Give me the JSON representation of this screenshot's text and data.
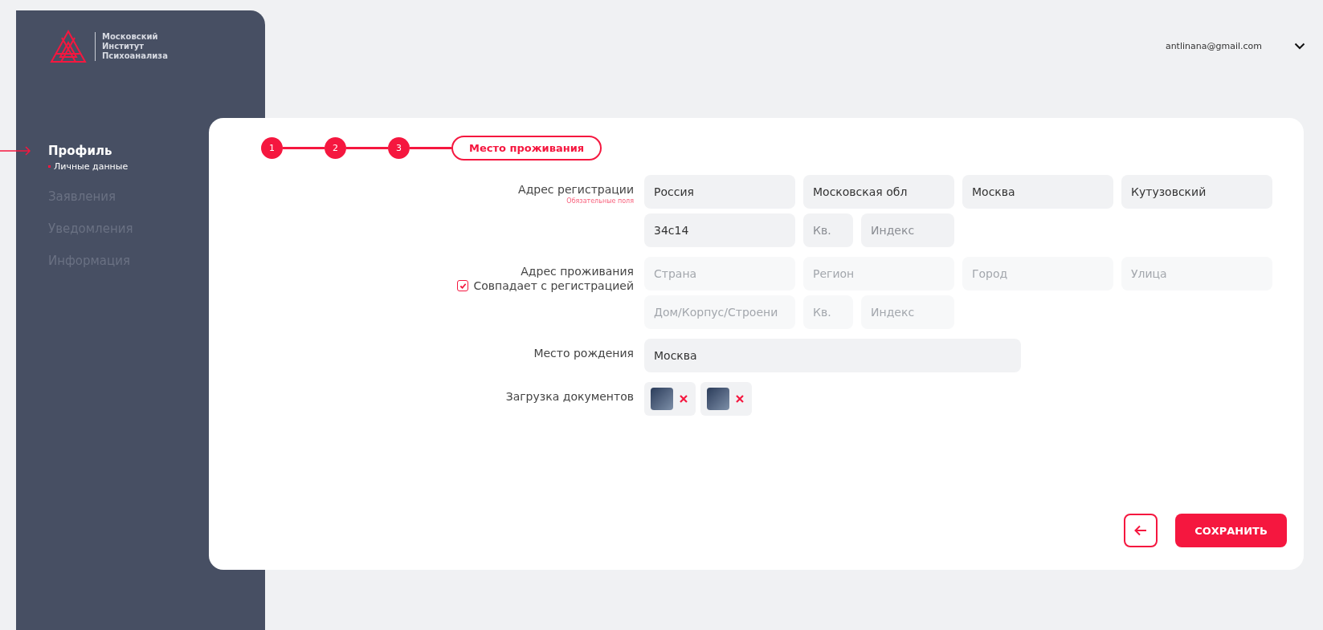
{
  "logo": {
    "lines": [
      "Московский",
      "Институт",
      "Психоанализа"
    ]
  },
  "sidebar": {
    "items": [
      {
        "label": "Профиль",
        "selected": true,
        "children": [
          {
            "label": "Личные данные",
            "selected": true
          }
        ]
      },
      {
        "label": "Заявления",
        "selected": false
      },
      {
        "label": "Уведомления",
        "selected": false
      },
      {
        "label": "Информация",
        "selected": false
      }
    ]
  },
  "user": {
    "email": "antlinana@gmail.com"
  },
  "steps": [
    {
      "label": "1",
      "selected": false
    },
    {
      "label": "2",
      "selected": false
    },
    {
      "label": "3",
      "selected": false
    },
    {
      "label": "Место проживания",
      "selected": true
    }
  ],
  "registration": {
    "label": "Адрес регистрации",
    "hint": "Обязательные поля",
    "fields": [
      {
        "value": "Россия",
        "kind": "wide"
      },
      {
        "value": "Московская обл",
        "kind": "wide"
      },
      {
        "value": "Москва",
        "kind": "wide"
      },
      {
        "value": "Кутузовский",
        "kind": "wide"
      },
      {
        "value": "34с14",
        "kind": "wide"
      },
      {
        "placeholder": "Кв.",
        "kind": "short"
      },
      {
        "placeholder": "Индекс",
        "kind": "medium"
      }
    ]
  },
  "residence": {
    "label": "Адрес проживания",
    "disabled": true,
    "checkbox": {
      "label": "Совпадает с регистрацией",
      "checked": true
    },
    "fields": [
      {
        "placeholder": "Страна",
        "kind": "wide"
      },
      {
        "placeholder": "Регион",
        "kind": "wide"
      },
      {
        "placeholder": "Город",
        "kind": "wide"
      },
      {
        "placeholder": "Улица",
        "kind": "wide"
      },
      {
        "placeholder": "Дом/Корпус/Строени",
        "kind": "wide"
      },
      {
        "placeholder": "Кв.",
        "kind": "short"
      },
      {
        "placeholder": "Индекс",
        "kind": "medium"
      }
    ]
  },
  "birthplace": {
    "label": "Место рождения",
    "value": "Москва"
  },
  "documents": {
    "label": "Загрузка документов",
    "files": [
      {
        "kind": "image"
      },
      {
        "kind": "image"
      }
    ]
  },
  "actions": {
    "save": "СОХРАНИТЬ"
  }
}
